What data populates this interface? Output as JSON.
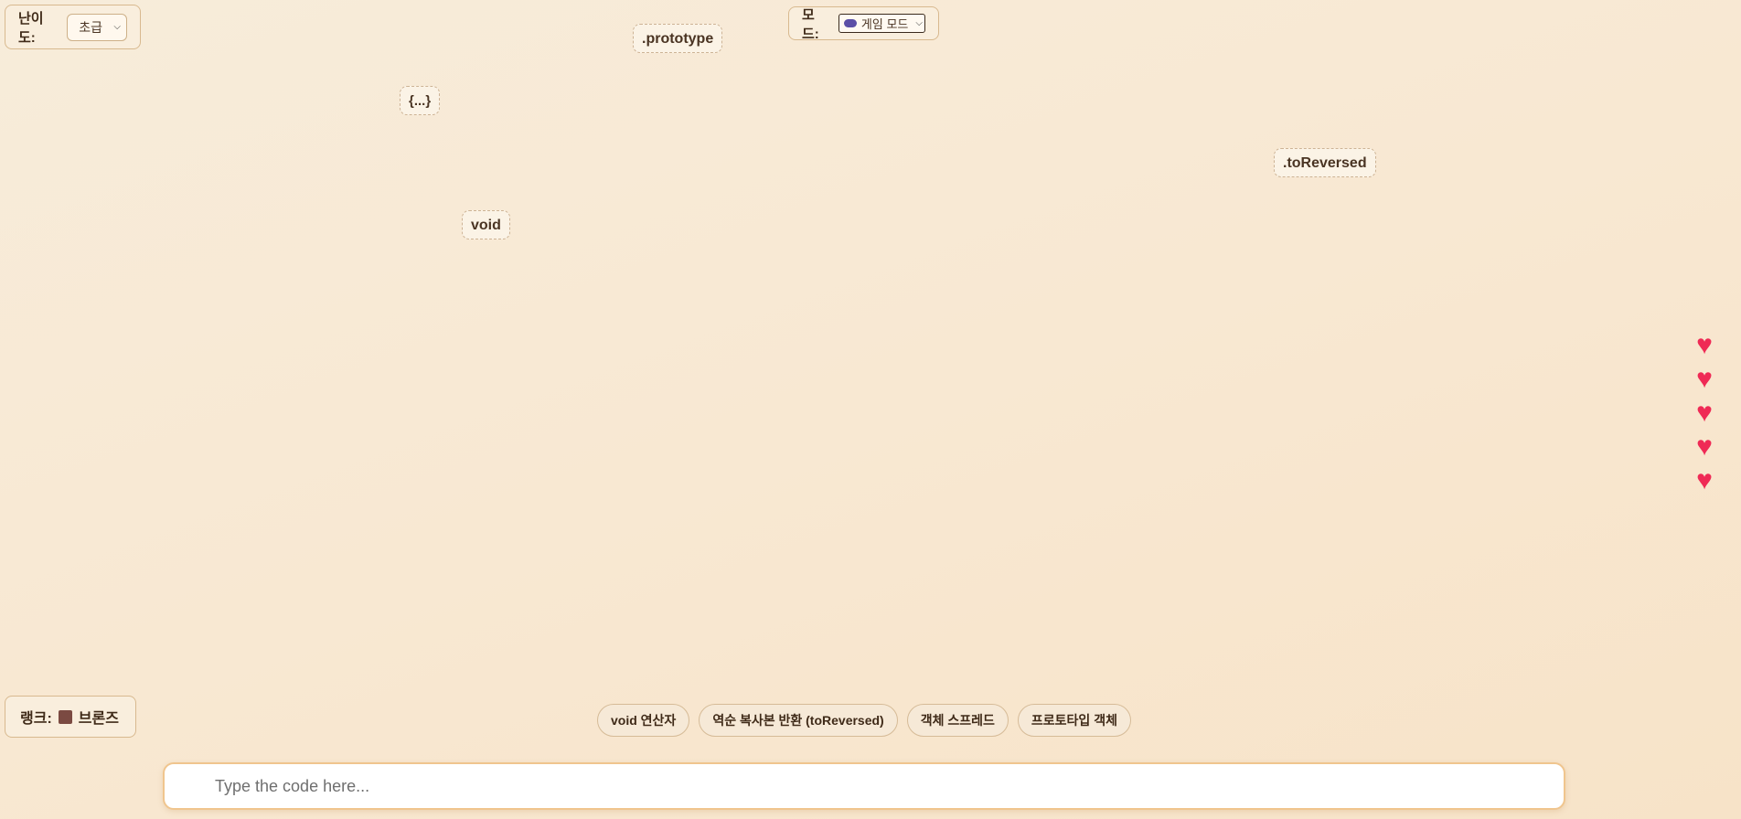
{
  "difficulty": {
    "label": "난이도:",
    "selected": "초급"
  },
  "mode": {
    "label": "모드:",
    "selected": "게임 모드",
    "icon": "gamepad-icon"
  },
  "rank": {
    "label": "랭크:",
    "value": "브론즈",
    "badge_color": "#7b4a42"
  },
  "tokens": [
    ".prototype",
    "{...}",
    ".toReversed",
    "void"
  ],
  "lives": {
    "count": 5,
    "icon": "heart-icon",
    "color": "#ef2a55"
  },
  "hints": [
    "void 연산자",
    "역순 복사본 반환 (toReversed)",
    "객체 스프레드",
    "프로토타입 객체"
  ],
  "input": {
    "placeholder": "Type the code here...",
    "value": ""
  }
}
